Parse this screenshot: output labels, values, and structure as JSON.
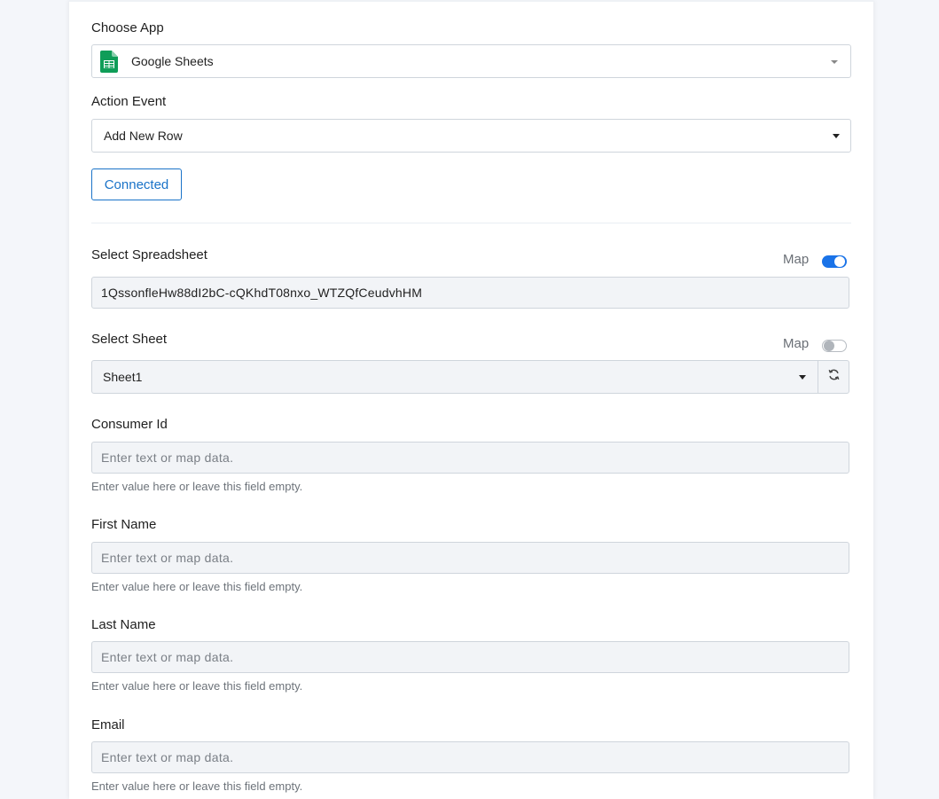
{
  "form": {
    "choose_app": {
      "label": "Choose App",
      "value": "Google Sheets",
      "icon": "google-sheets-icon"
    },
    "action_event": {
      "label": "Action Event",
      "value": "Add New Row"
    },
    "connected_button": "Connected",
    "spreadsheet": {
      "label": "Select Spreadsheet",
      "map_label": "Map",
      "map_enabled": true,
      "value": "1QssonfleHw88dI2bC-cQKhdT08nxo_WTZQfCeudvhHM"
    },
    "sheet": {
      "label": "Select Sheet",
      "map_label": "Map",
      "map_enabled": false,
      "value": "Sheet1",
      "refresh_icon": "refresh-icon"
    },
    "fields": [
      {
        "label": "Consumer Id",
        "placeholder": "Enter text or map data.",
        "help": "Enter value here or leave this field empty."
      },
      {
        "label": "First Name",
        "placeholder": "Enter text or map data.",
        "help": "Enter value here or leave this field empty."
      },
      {
        "label": "Last Name",
        "placeholder": "Enter text or map data.",
        "help": "Enter value here or leave this field empty."
      },
      {
        "label": "Email",
        "placeholder": "Enter text or map data.",
        "help": "Enter value here or leave this field empty."
      }
    ]
  },
  "colors": {
    "accent": "#1a73c8",
    "toggle_on": "#1a73e8",
    "sheets_green": "#0f9d58"
  }
}
